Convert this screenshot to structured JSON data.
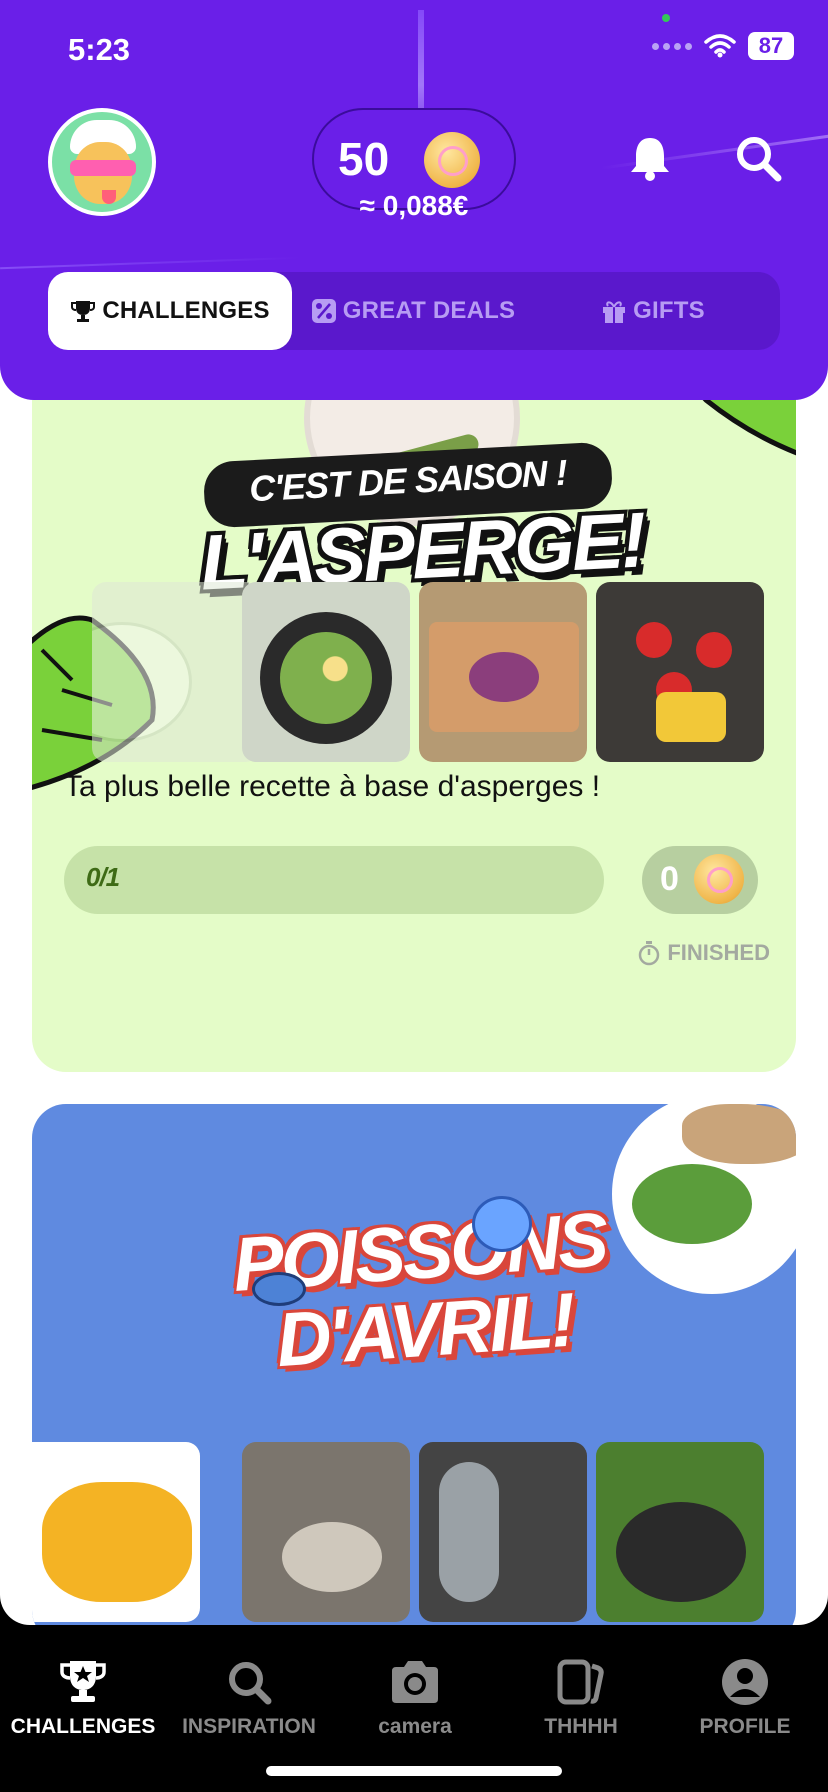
{
  "status_bar": {
    "time": "5:23",
    "battery": "87"
  },
  "header": {
    "coins": "50",
    "coins_euro": "≈ 0,088€",
    "tabs": [
      {
        "label": "CHALLENGES",
        "icon": "trophy-icon",
        "active": true
      },
      {
        "label": "GREAT DEALS",
        "icon": "percent-icon",
        "active": false
      },
      {
        "label": "GIFTS",
        "icon": "gift-icon",
        "active": false
      }
    ]
  },
  "challenges": [
    {
      "banner_line1": "C'EST DE SAISON !",
      "banner_line2": "L'ASPERGE!",
      "title": "Ta plus belle recette à base d'asperges !",
      "progress_text": "0/1",
      "progress": 0,
      "reward": "0",
      "status": "FINISHED",
      "color": "#e4fcc8"
    },
    {
      "banner_line1": "POISSONS",
      "banner_line2": "D'AVRIL!",
      "color": "#5f8ae0"
    }
  ],
  "bottom_nav": [
    {
      "label": "CHALLENGES",
      "icon": "trophy-star-icon",
      "active": true
    },
    {
      "label": "INSPIRATION",
      "icon": "search-icon",
      "active": false
    },
    {
      "label": "camera",
      "icon": "camera-icon",
      "active": false
    },
    {
      "label": "THHHH",
      "icon": "cards-icon",
      "active": false
    },
    {
      "label": "PROFILE",
      "icon": "profile-icon",
      "active": false
    }
  ],
  "colors": {
    "brand": "#6a1fe8",
    "accent_green": "#8fd14f"
  }
}
